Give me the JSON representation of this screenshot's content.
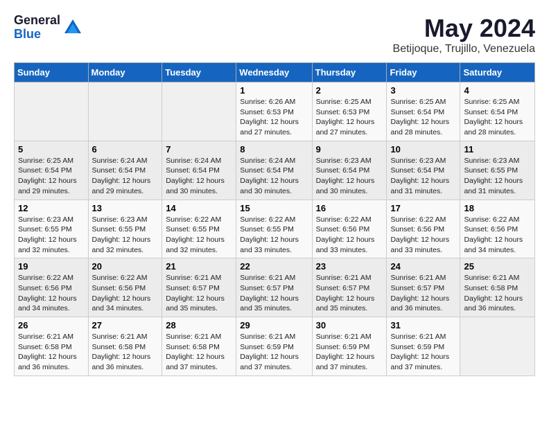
{
  "logo": {
    "general": "General",
    "blue": "Blue"
  },
  "title": "May 2024",
  "subtitle": "Betijoque, Trujillo, Venezuela",
  "days_header": [
    "Sunday",
    "Monday",
    "Tuesday",
    "Wednesday",
    "Thursday",
    "Friday",
    "Saturday"
  ],
  "weeks": [
    [
      {
        "day": "",
        "info": ""
      },
      {
        "day": "",
        "info": ""
      },
      {
        "day": "",
        "info": ""
      },
      {
        "day": "1",
        "info": "Sunrise: 6:26 AM\nSunset: 6:53 PM\nDaylight: 12 hours\nand 27 minutes."
      },
      {
        "day": "2",
        "info": "Sunrise: 6:25 AM\nSunset: 6:53 PM\nDaylight: 12 hours\nand 27 minutes."
      },
      {
        "day": "3",
        "info": "Sunrise: 6:25 AM\nSunset: 6:54 PM\nDaylight: 12 hours\nand 28 minutes."
      },
      {
        "day": "4",
        "info": "Sunrise: 6:25 AM\nSunset: 6:54 PM\nDaylight: 12 hours\nand 28 minutes."
      }
    ],
    [
      {
        "day": "5",
        "info": "Sunrise: 6:25 AM\nSunset: 6:54 PM\nDaylight: 12 hours\nand 29 minutes."
      },
      {
        "day": "6",
        "info": "Sunrise: 6:24 AM\nSunset: 6:54 PM\nDaylight: 12 hours\nand 29 minutes."
      },
      {
        "day": "7",
        "info": "Sunrise: 6:24 AM\nSunset: 6:54 PM\nDaylight: 12 hours\nand 30 minutes."
      },
      {
        "day": "8",
        "info": "Sunrise: 6:24 AM\nSunset: 6:54 PM\nDaylight: 12 hours\nand 30 minutes."
      },
      {
        "day": "9",
        "info": "Sunrise: 6:23 AM\nSunset: 6:54 PM\nDaylight: 12 hours\nand 30 minutes."
      },
      {
        "day": "10",
        "info": "Sunrise: 6:23 AM\nSunset: 6:54 PM\nDaylight: 12 hours\nand 31 minutes."
      },
      {
        "day": "11",
        "info": "Sunrise: 6:23 AM\nSunset: 6:55 PM\nDaylight: 12 hours\nand 31 minutes."
      }
    ],
    [
      {
        "day": "12",
        "info": "Sunrise: 6:23 AM\nSunset: 6:55 PM\nDaylight: 12 hours\nand 32 minutes."
      },
      {
        "day": "13",
        "info": "Sunrise: 6:23 AM\nSunset: 6:55 PM\nDaylight: 12 hours\nand 32 minutes."
      },
      {
        "day": "14",
        "info": "Sunrise: 6:22 AM\nSunset: 6:55 PM\nDaylight: 12 hours\nand 32 minutes."
      },
      {
        "day": "15",
        "info": "Sunrise: 6:22 AM\nSunset: 6:55 PM\nDaylight: 12 hours\nand 33 minutes."
      },
      {
        "day": "16",
        "info": "Sunrise: 6:22 AM\nSunset: 6:56 PM\nDaylight: 12 hours\nand 33 minutes."
      },
      {
        "day": "17",
        "info": "Sunrise: 6:22 AM\nSunset: 6:56 PM\nDaylight: 12 hours\nand 33 minutes."
      },
      {
        "day": "18",
        "info": "Sunrise: 6:22 AM\nSunset: 6:56 PM\nDaylight: 12 hours\nand 34 minutes."
      }
    ],
    [
      {
        "day": "19",
        "info": "Sunrise: 6:22 AM\nSunset: 6:56 PM\nDaylight: 12 hours\nand 34 minutes."
      },
      {
        "day": "20",
        "info": "Sunrise: 6:22 AM\nSunset: 6:56 PM\nDaylight: 12 hours\nand 34 minutes."
      },
      {
        "day": "21",
        "info": "Sunrise: 6:21 AM\nSunset: 6:57 PM\nDaylight: 12 hours\nand 35 minutes."
      },
      {
        "day": "22",
        "info": "Sunrise: 6:21 AM\nSunset: 6:57 PM\nDaylight: 12 hours\nand 35 minutes."
      },
      {
        "day": "23",
        "info": "Sunrise: 6:21 AM\nSunset: 6:57 PM\nDaylight: 12 hours\nand 35 minutes."
      },
      {
        "day": "24",
        "info": "Sunrise: 6:21 AM\nSunset: 6:57 PM\nDaylight: 12 hours\nand 36 minutes."
      },
      {
        "day": "25",
        "info": "Sunrise: 6:21 AM\nSunset: 6:58 PM\nDaylight: 12 hours\nand 36 minutes."
      }
    ],
    [
      {
        "day": "26",
        "info": "Sunrise: 6:21 AM\nSunset: 6:58 PM\nDaylight: 12 hours\nand 36 minutes."
      },
      {
        "day": "27",
        "info": "Sunrise: 6:21 AM\nSunset: 6:58 PM\nDaylight: 12 hours\nand 36 minutes."
      },
      {
        "day": "28",
        "info": "Sunrise: 6:21 AM\nSunset: 6:58 PM\nDaylight: 12 hours\nand 37 minutes."
      },
      {
        "day": "29",
        "info": "Sunrise: 6:21 AM\nSunset: 6:59 PM\nDaylight: 12 hours\nand 37 minutes."
      },
      {
        "day": "30",
        "info": "Sunrise: 6:21 AM\nSunset: 6:59 PM\nDaylight: 12 hours\nand 37 minutes."
      },
      {
        "day": "31",
        "info": "Sunrise: 6:21 AM\nSunset: 6:59 PM\nDaylight: 12 hours\nand 37 minutes."
      },
      {
        "day": "",
        "info": ""
      }
    ]
  ]
}
